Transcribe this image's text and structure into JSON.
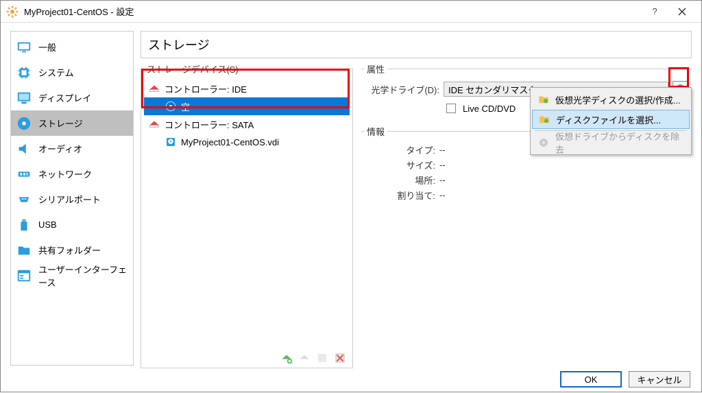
{
  "window": {
    "title": "MyProject01-CentOS - 設定"
  },
  "sidebar": {
    "items": [
      {
        "label": "一般"
      },
      {
        "label": "システム"
      },
      {
        "label": "ディスプレイ"
      },
      {
        "label": "ストレージ"
      },
      {
        "label": "オーディオ"
      },
      {
        "label": "ネットワーク"
      },
      {
        "label": "シリアルポート"
      },
      {
        "label": "USB"
      },
      {
        "label": "共有フォルダー"
      },
      {
        "label": "ユーザーインターフェース"
      }
    ]
  },
  "page": {
    "title": "ストレージ"
  },
  "storage_devices": {
    "legend": "ストレージデバイス(S)",
    "ide_controller": "コントローラー: IDE",
    "ide_empty": "空",
    "sata_controller": "コントローラー: SATA",
    "sata_disk": "MyProject01-CentOS.vdi"
  },
  "attributes": {
    "legend": "属性",
    "optical_drive_label": "光学ドライブ(D):",
    "optical_drive_value": "IDE セカンダリマスター",
    "live_cd_label": "Live CD/DVD"
  },
  "info": {
    "legend": "情報",
    "type_label": "タイプ:",
    "size_label": "サイズ:",
    "location_label": "場所:",
    "allocation_label": "割り当て:",
    "dash": "--"
  },
  "menu": {
    "choose_create": "仮想光学ディスクの選択/作成...",
    "choose_file": "ディスクファイルを選択...",
    "remove": "仮想ドライブからディスクを除去"
  },
  "buttons": {
    "ok": "OK",
    "cancel": "キャンセル"
  }
}
